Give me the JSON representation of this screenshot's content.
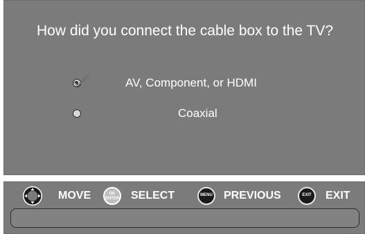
{
  "screen": {
    "question": "How did you connect the cable box to the TV?",
    "options": [
      {
        "label": "AV, Component, or HDMI",
        "selected": true
      },
      {
        "label": "Coaxial",
        "selected": false
      }
    ]
  },
  "navbar": {
    "move": {
      "icon": "dpad-icon",
      "label": "MOVE"
    },
    "select": {
      "icon": "ok-enter-icon",
      "button_line1": "OK",
      "button_line2": "ENTER",
      "label": "SELECT"
    },
    "previous": {
      "icon": "menu-button-icon",
      "button_text": "MENU",
      "label": "PREVIOUS"
    },
    "exit": {
      "icon": "exit-button-icon",
      "button_text": "EXIT",
      "label": "EXIT"
    },
    "status_text": ""
  },
  "colors": {
    "panel": "#7b7b7b",
    "text": "#ffffff",
    "button_dark": "#1a1a1a",
    "button_light": "#bdbdbd"
  }
}
